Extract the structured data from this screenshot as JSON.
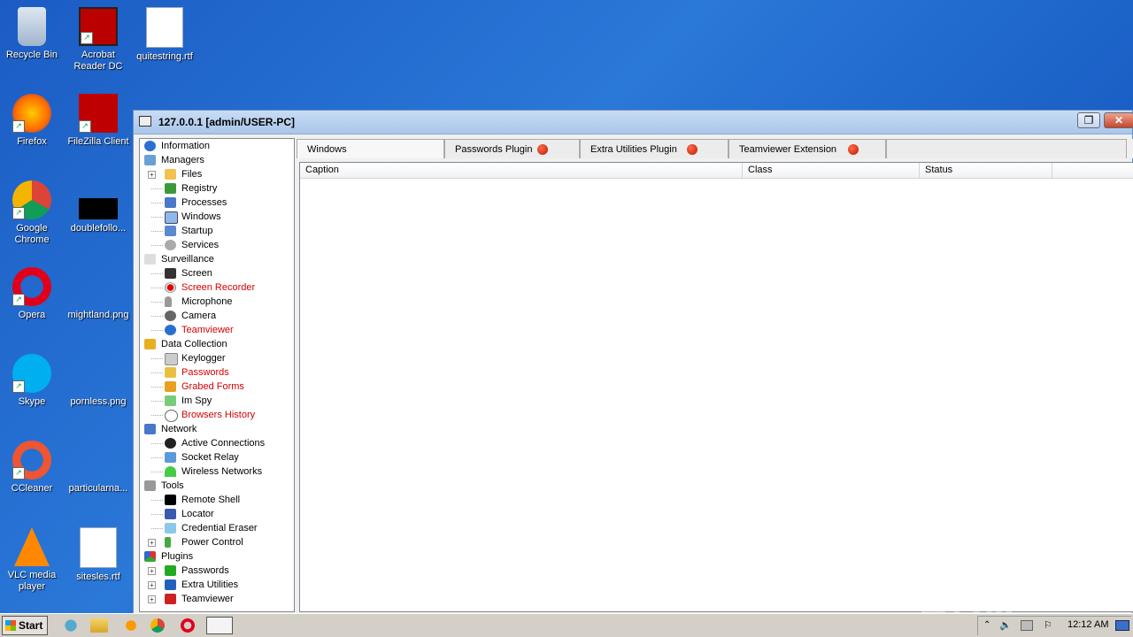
{
  "desktop": {
    "icons": [
      {
        "label": "Recycle Bin"
      },
      {
        "label": "Acrobat Reader DC"
      },
      {
        "label": "quitestring.rtf"
      },
      {
        "label": "Firefox"
      },
      {
        "label": "FileZilla Client"
      },
      {
        "label": "Google Chrome"
      },
      {
        "label": "doublefollo..."
      },
      {
        "label": "Opera"
      },
      {
        "label": "mightland.png"
      },
      {
        "label": "Skype"
      },
      {
        "label": "pornless.png"
      },
      {
        "label": "CCleaner"
      },
      {
        "label": "particularna..."
      },
      {
        "label": "VLC media player"
      },
      {
        "label": "sitesles.rtf"
      }
    ]
  },
  "window": {
    "title": "127.0.0.1 [admin/USER-PC]",
    "max_glyph": "❐",
    "close_glyph": "✕"
  },
  "tree": {
    "information": "Information",
    "managers": "Managers",
    "files": "Files",
    "registry": "Registry",
    "processes": "Processes",
    "windows": "Windows",
    "startup": "Startup",
    "services": "Services",
    "surveillance": "Surveillance",
    "screen": "Screen",
    "screen_recorder": "Screen Recorder",
    "microphone": "Microphone",
    "camera": "Camera",
    "teamviewer": "Teamviewer",
    "data_collection": "Data Collection",
    "keylogger": "Keylogger",
    "passwords": "Passwords",
    "grabed_forms": "Grabed Forms",
    "im_spy": "Im Spy",
    "browsers_history": "Browsers History",
    "network": "Network",
    "active_connections": "Active Connections",
    "socket_relay": "Socket Relay",
    "wireless_networks": "Wireless Networks",
    "tools": "Tools",
    "remote_shell": "Remote Shell",
    "locator": "Locator",
    "credential_eraser": "Credential Eraser",
    "power_control": "Power Control",
    "plugins": "Plugins",
    "plugin_passwords": "Passwords",
    "plugin_extra": "Extra Utilities",
    "plugin_teamviewer": "Teamviewer",
    "expand_glyph": "+"
  },
  "tabs": [
    "Windows",
    "Passwords Plugin",
    "Extra Utilities Plugin",
    "Teamviewer Extension"
  ],
  "columns": [
    "Caption",
    "Class",
    "Status"
  ],
  "taskbar": {
    "start_label": "Start",
    "clock": "12:12 AM"
  },
  "watermark": "ANY ▷ RUN",
  "colors": {
    "desktop": "#1b5cc4",
    "alert_red": "#d40000",
    "tab_dot": "#c01800"
  }
}
